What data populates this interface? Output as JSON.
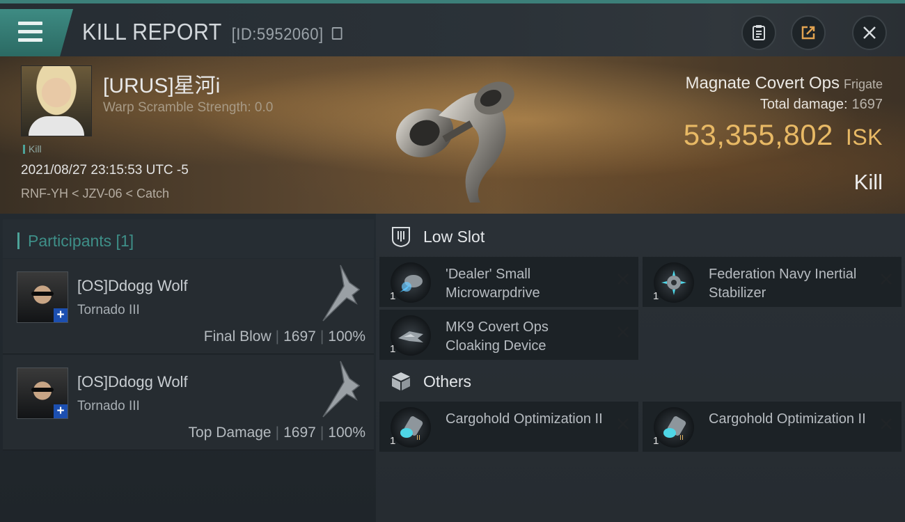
{
  "header": {
    "title": "KILL REPORT",
    "report_id": "[ID:5952060]"
  },
  "victim": {
    "name": "[URUS]星河i",
    "warp_scramble": "Warp Scramble Strength: 0.0",
    "tag": "Kill",
    "datetime": "2021/08/27 23:15:53 UTC -5",
    "route": "RNF-YH < JZV-06 < Catch",
    "ship_name": "Magnate Covert Ops",
    "ship_class": "Frigate",
    "total_damage_label": "Total damage:",
    "total_damage_value": "1697",
    "isk_value": "53,355,802",
    "isk_unit": "ISK",
    "result": "Kill"
  },
  "participants": {
    "title": "Participants [1]",
    "rows": [
      {
        "name": "[OS]Ddogg Wolf",
        "ship": "Tornado III",
        "role": "Final Blow",
        "damage": "1697",
        "percent": "100%"
      },
      {
        "name": "[OS]Ddogg Wolf",
        "ship": "Tornado III",
        "role": "Top Damage",
        "damage": "1697",
        "percent": "100%"
      }
    ]
  },
  "modules": {
    "low_slot_title": "Low Slot",
    "others_title": "Others",
    "low_slot": [
      {
        "name": "'Dealer' Small Microwarpdrive",
        "qty": "1",
        "icon": "microwarpdrive-icon"
      },
      {
        "name": "Federation Navy Inertial Stabilizer",
        "qty": "1",
        "icon": "inertial-stabilizer-icon"
      },
      {
        "name": "MK9 Covert Ops Cloaking Device",
        "qty": "1",
        "icon": "cloaking-device-icon"
      }
    ],
    "others": [
      {
        "name": "Cargohold Optimization II",
        "qty": "1",
        "icon": "cargohold-optimization-icon"
      },
      {
        "name": "Cargohold Optimization II",
        "qty": "1",
        "icon": "cargohold-optimization-icon"
      }
    ]
  },
  "colors": {
    "accent": "#3e8b83",
    "isk": "#e8b965"
  }
}
